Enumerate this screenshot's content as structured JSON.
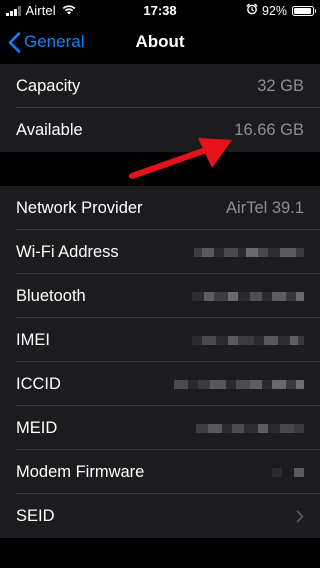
{
  "status_bar": {
    "carrier": "Airtel",
    "time": "17:38",
    "battery_percent": "92%",
    "battery_level": 0.92,
    "signal_bars": 4,
    "signal_bars_filled": 3,
    "icons": [
      "signal-icon",
      "wifi-icon",
      "alarm-icon",
      "battery-icon"
    ]
  },
  "nav": {
    "back_label": "General",
    "title": "About"
  },
  "storage": {
    "rows": [
      {
        "label": "Capacity",
        "value": "32 GB"
      },
      {
        "label": "Available",
        "value": "16.66 GB"
      }
    ]
  },
  "network": {
    "rows": [
      {
        "label": "Network Provider",
        "value": "AirTel 39.1"
      },
      {
        "label": "Wi-Fi Address"
      },
      {
        "label": "Bluetooth"
      },
      {
        "label": "IMEI"
      },
      {
        "label": "ICCID"
      },
      {
        "label": "MEID"
      },
      {
        "label": "Modem Firmware"
      },
      {
        "label": "SEID"
      }
    ]
  },
  "colors": {
    "accent": "#0a84ff",
    "cell_background": "#1c1c1e",
    "background": "#000000",
    "secondary_text": "#8e8e93",
    "annotation_arrow": "#e8121b"
  }
}
